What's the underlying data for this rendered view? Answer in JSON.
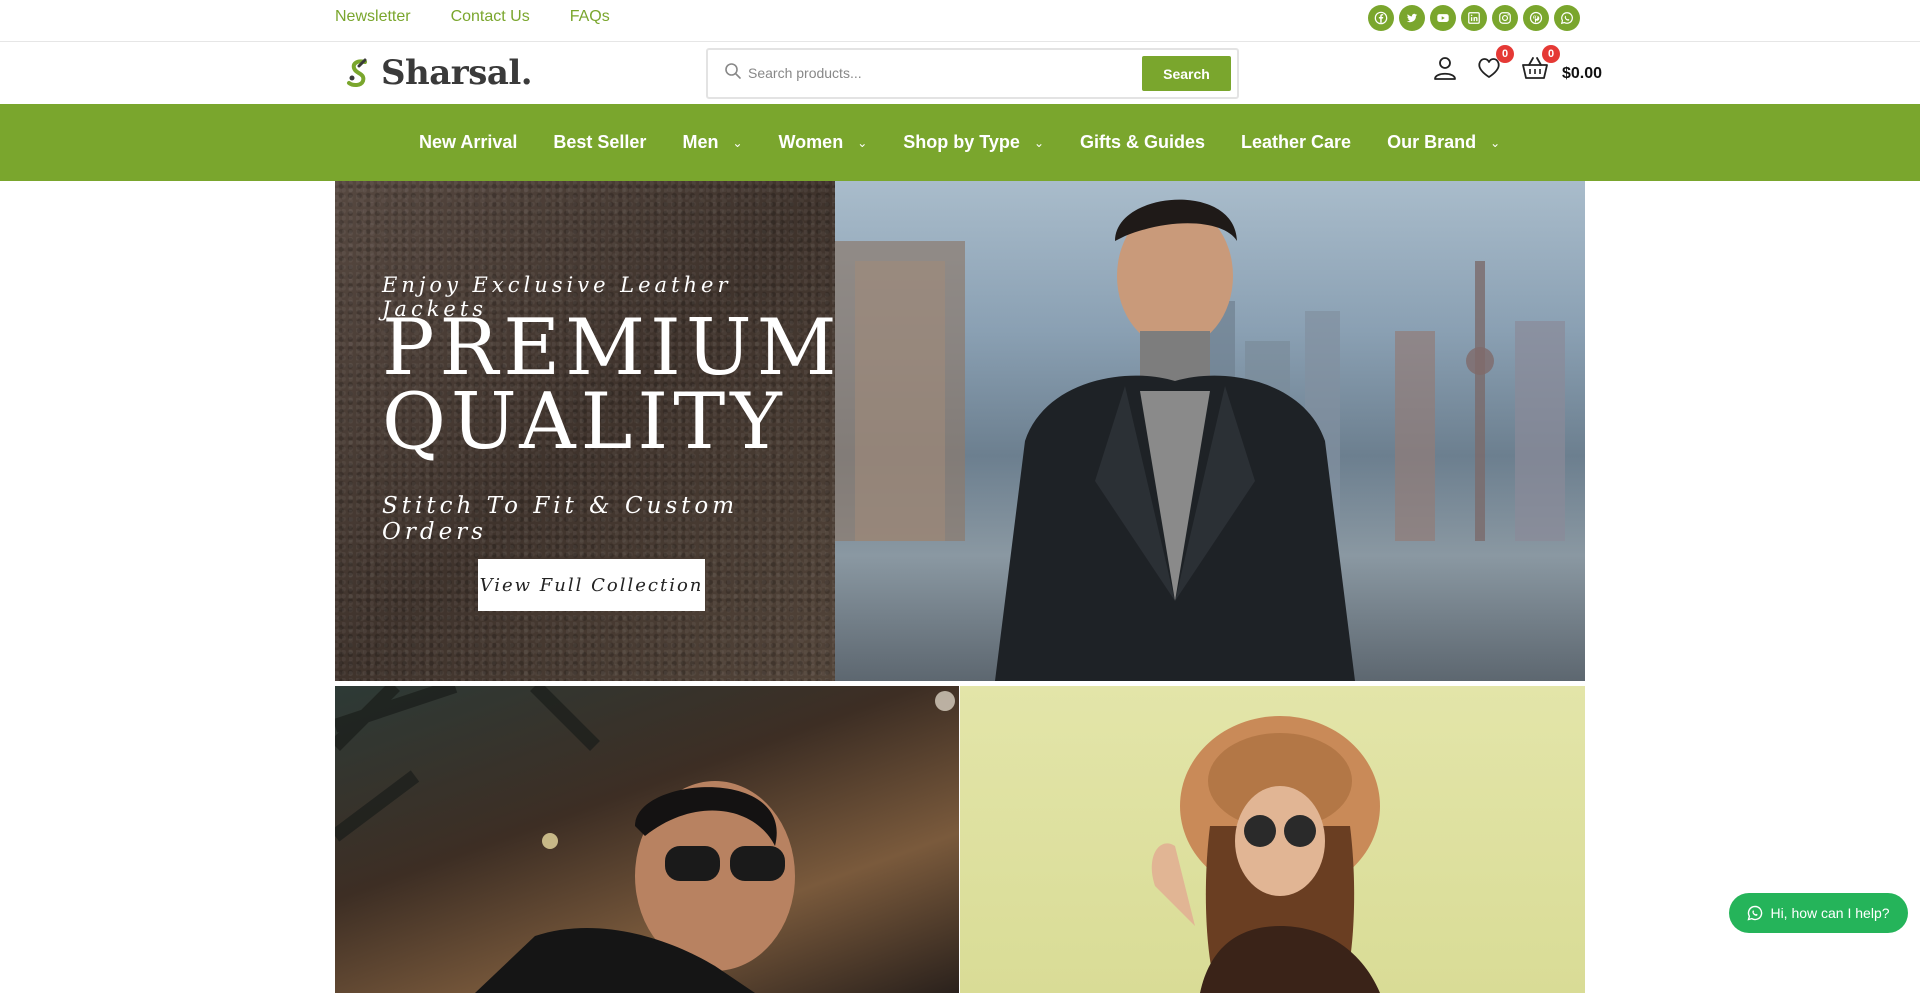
{
  "topbar": {
    "links": [
      "Newsletter",
      "Contact Us",
      "FAQs"
    ],
    "socials": [
      "facebook-icon",
      "twitter-icon",
      "youtube-icon",
      "linkedin-icon",
      "instagram-icon",
      "pinterest-icon",
      "whatsapp-icon"
    ]
  },
  "header": {
    "logo_text": "Sharsal.",
    "search": {
      "placeholder": "Search products...",
      "button_label": "Search"
    },
    "wishlist_count": "0",
    "cart_count": "0",
    "cart_total": "$0.00"
  },
  "nav": {
    "items": [
      {
        "label": "New Arrival",
        "dropdown": false
      },
      {
        "label": "Best Seller",
        "dropdown": false
      },
      {
        "label": "Men",
        "dropdown": true
      },
      {
        "label": "Women",
        "dropdown": true
      },
      {
        "label": "Shop by Type",
        "dropdown": true
      },
      {
        "label": "Gifts & Guides",
        "dropdown": false
      },
      {
        "label": "Leather Care",
        "dropdown": false
      },
      {
        "label": "Our Brand",
        "dropdown": true
      }
    ]
  },
  "hero": {
    "eyebrow": "Enjoy Exclusive Leather Jackets",
    "title_line1": "PREMIUM",
    "title_line2": "QUALITY",
    "subtitle": "Stitch To Fit & Custom Orders",
    "cta_label": "View Full Collection"
  },
  "chat": {
    "label": "Hi, how can I help?"
  },
  "colors": {
    "accent": "#7aa62d",
    "badge": "#e53935",
    "chat": "#25b45a"
  }
}
